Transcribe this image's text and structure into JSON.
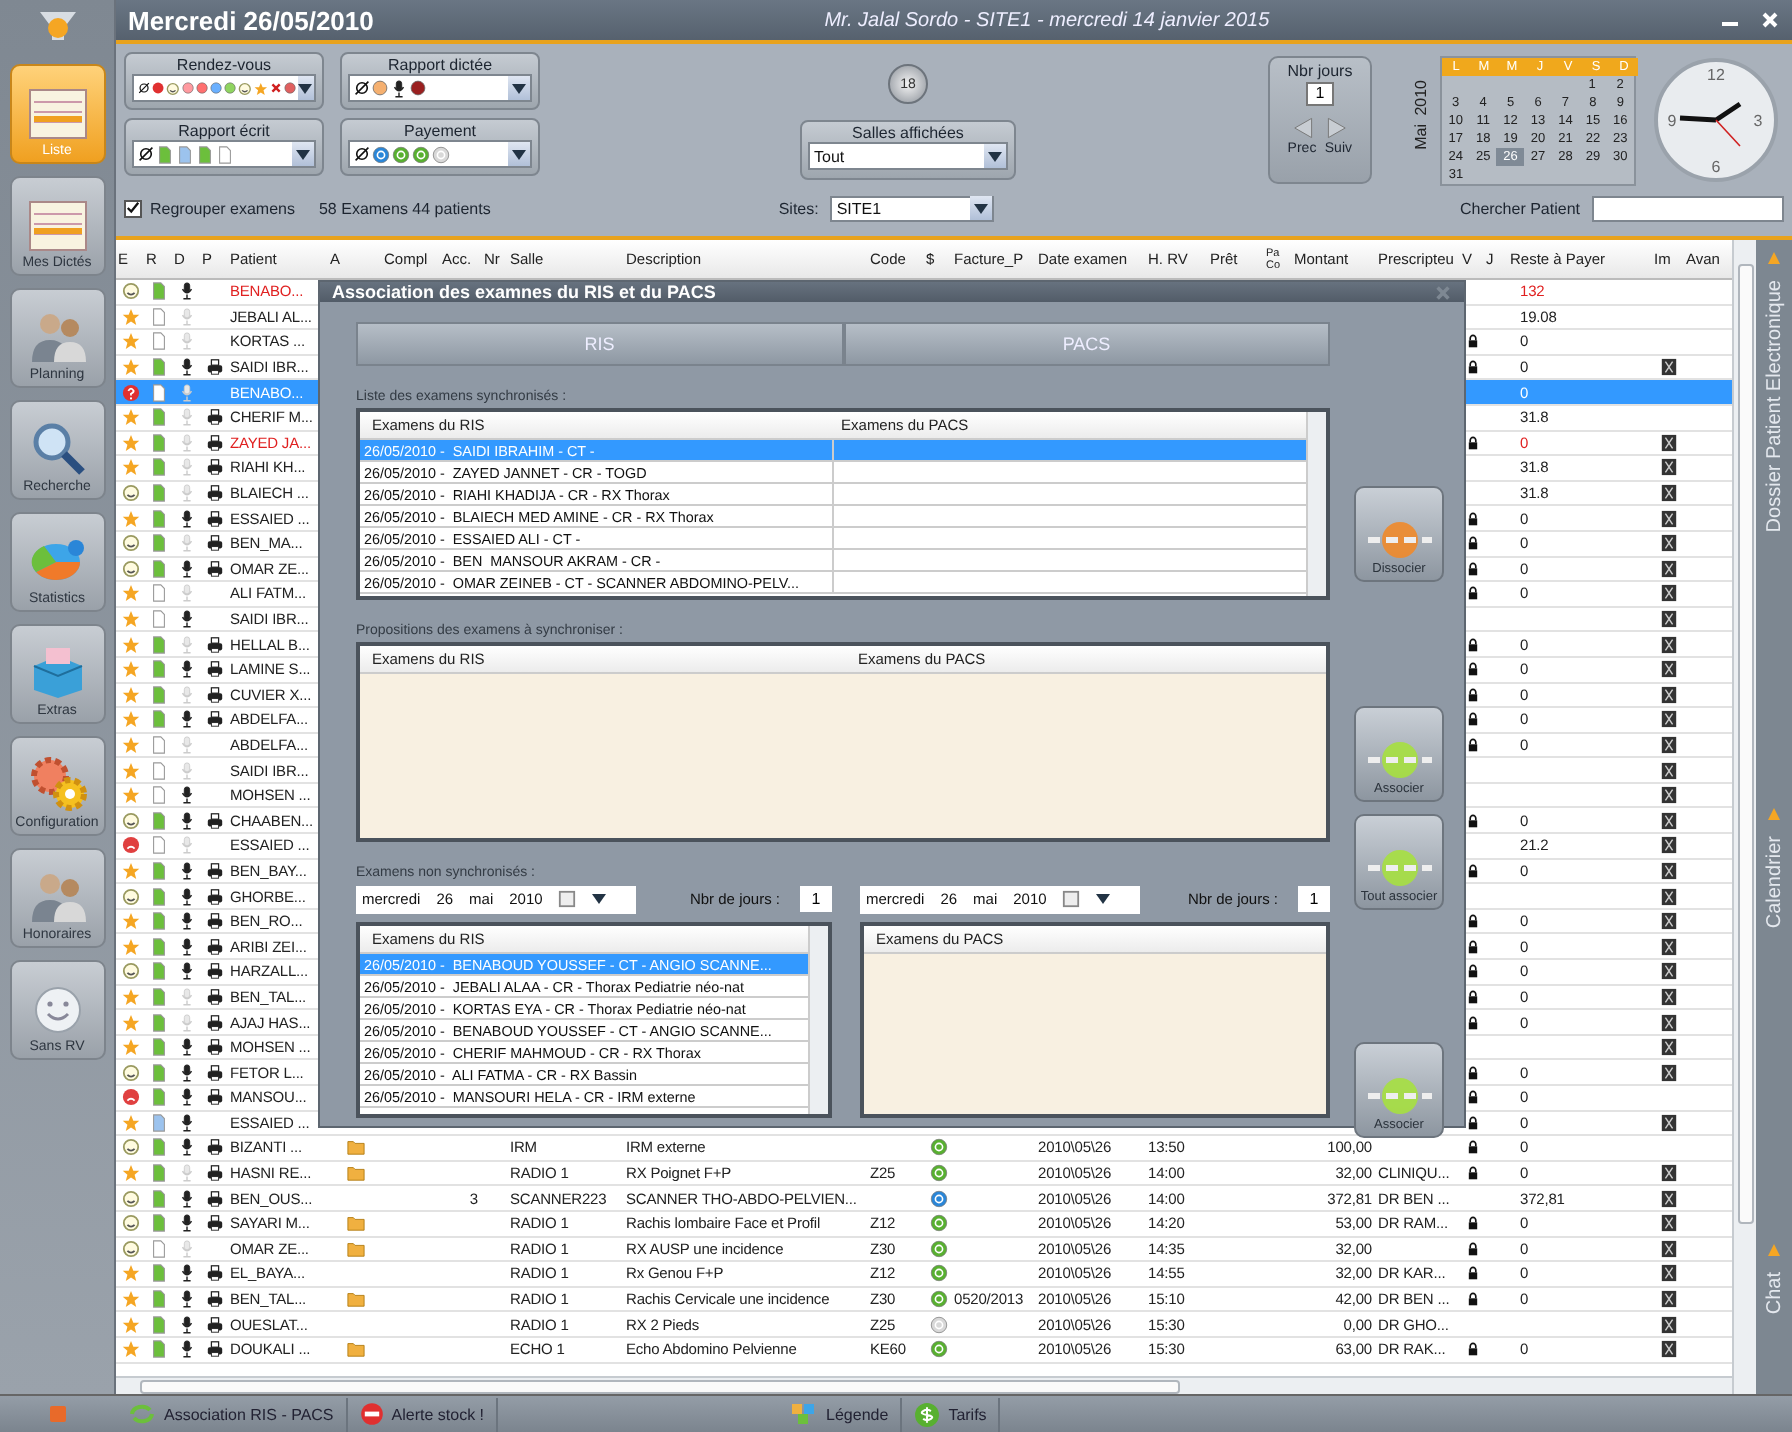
{
  "header": {
    "date": "Mercredi 26/05/2010",
    "title": "Mr. Jalal Sordo - SITE1 - mercredi 14 janvier 2015"
  },
  "sidebar": {
    "items": [
      {
        "label": "Liste",
        "kind": "list",
        "selected": true
      },
      {
        "label": "Mes Dictés",
        "kind": "list",
        "selected": false
      },
      {
        "label": "Planning",
        "kind": "people",
        "selected": false
      },
      {
        "label": "Recherche",
        "kind": "search",
        "selected": false
      },
      {
        "label": "Statistics",
        "kind": "pie",
        "selected": false
      },
      {
        "label": "Extras",
        "kind": "box",
        "selected": false
      },
      {
        "label": "Configuration",
        "kind": "gear",
        "selected": false
      },
      {
        "label": "Honoraires",
        "kind": "people",
        "selected": false
      },
      {
        "label": "Sans RV",
        "kind": "smiley",
        "selected": false
      }
    ]
  },
  "filters": [
    {
      "label": "Rendez-vous",
      "kind": "rdv"
    },
    {
      "label": "Rapport dictée",
      "kind": "dictee"
    },
    {
      "label": "Rapport écrit",
      "kind": "ecrit"
    },
    {
      "label": "Payement",
      "kind": "paiement"
    }
  ],
  "room_count": "18",
  "rooms": {
    "label": "Salles affichées",
    "value": "Tout"
  },
  "days": {
    "label": "Nbr jours",
    "value": "1",
    "prev": "Prec",
    "next": "Suiv"
  },
  "month": {
    "month": "Mai",
    "year": "2010"
  },
  "calendar": {
    "weekdays": [
      "L",
      "M",
      "M",
      "J",
      "V",
      "S",
      "D"
    ],
    "weeks": [
      [
        {
          "d": "1",
          "selected": false
        },
        {
          "d": "2",
          "selected": false
        }
      ],
      [
        {
          "d": "3",
          "selected": false
        },
        {
          "d": "4",
          "selected": false
        },
        {
          "d": "5",
          "selected": false
        },
        {
          "d": "6",
          "selected": false
        },
        {
          "d": "7",
          "selected": false
        },
        {
          "d": "8",
          "selected": false
        },
        {
          "d": "9",
          "selected": false
        }
      ],
      [
        {
          "d": "10",
          "selected": false
        },
        {
          "d": "11",
          "selected": false
        },
        {
          "d": "12",
          "selected": false
        },
        {
          "d": "13",
          "selected": false
        },
        {
          "d": "14",
          "selected": false
        },
        {
          "d": "15",
          "selected": false
        },
        {
          "d": "16",
          "selected": false
        }
      ],
      [
        {
          "d": "17",
          "selected": false
        },
        {
          "d": "18",
          "selected": false
        },
        {
          "d": "19",
          "selected": false
        },
        {
          "d": "20",
          "selected": false
        },
        {
          "d": "21",
          "selected": false
        },
        {
          "d": "22",
          "selected": false
        },
        {
          "d": "23",
          "selected": false
        }
      ],
      [
        {
          "d": "24",
          "selected": false
        },
        {
          "d": "25",
          "selected": false
        },
        {
          "d": "26",
          "selected": true
        },
        {
          "d": "27",
          "selected": false
        },
        {
          "d": "28",
          "selected": false
        },
        {
          "d": "29",
          "selected": false
        },
        {
          "d": "30",
          "selected": false
        }
      ],
      [
        {
          "d": "31",
          "selected": false
        }
      ]
    ]
  },
  "clock": {
    "numerals": [
      "12",
      "3",
      "6",
      "9"
    ]
  },
  "options": {
    "group_label": "Regrouper examens",
    "group_checked": true,
    "summary": "58 Examens 44 patients",
    "sites_label": "Sites:",
    "site": "SITE1",
    "search_label": "Chercher Patient"
  },
  "table": {
    "columns": [
      "E",
      "R",
      "D",
      "P",
      "Patient",
      "A",
      "Compl",
      "Acc.",
      "Nr",
      "Salle",
      "Description",
      "Code",
      "$",
      "Facture_P",
      "Date examen",
      "H. RV",
      "Prêt",
      "Pa Co",
      "Montant",
      "Prescripteu",
      "V",
      "J",
      "Reste à Payer",
      "Im",
      "Avan"
    ],
    "rows": [
      {
        "status": {
          "kind": "smile"
        },
        "report": {
          "kind": "done"
        },
        "d": true,
        "p": false,
        "patient": "BENABO...",
        "flagged": true,
        "selected": false,
        "v": false,
        "reste": "132",
        "reste_flagged": true,
        "im": false
      },
      {
        "status": {
          "kind": "star"
        },
        "report": {
          "kind": "empty"
        },
        "d": false,
        "p": false,
        "patient": "JEBALI AL...",
        "flagged": false,
        "selected": false,
        "v": false,
        "reste": "19.08",
        "reste_flagged": false,
        "im": false
      },
      {
        "status": {
          "kind": "star"
        },
        "report": {
          "kind": "empty"
        },
        "d": false,
        "p": false,
        "patient": "KORTAS ...",
        "flagged": false,
        "selected": false,
        "v": true,
        "reste": "0",
        "reste_flagged": false,
        "im": false
      },
      {
        "status": {
          "kind": "star"
        },
        "report": {
          "kind": "done"
        },
        "d": true,
        "p": true,
        "patient": "SAIDI IBR...",
        "flagged": false,
        "selected": false,
        "v": true,
        "reste": "0",
        "reste_flagged": false,
        "im": true
      },
      {
        "status": {
          "kind": "help"
        },
        "report": {
          "kind": "empty"
        },
        "d": false,
        "p": false,
        "patient": "BENABO...",
        "flagged": false,
        "selected": true,
        "v": false,
        "reste": "0",
        "reste_flagged": false,
        "im": false
      },
      {
        "status": {
          "kind": "star"
        },
        "report": {
          "kind": "done"
        },
        "d": false,
        "p": true,
        "patient": "CHERIF M...",
        "flagged": false,
        "selected": false,
        "v": false,
        "reste": "31.8",
        "reste_flagged": false,
        "im": false
      },
      {
        "status": {
          "kind": "star"
        },
        "report": {
          "kind": "done"
        },
        "d": false,
        "p": true,
        "patient": "ZAYED JA...",
        "flagged": true,
        "selected": false,
        "v": true,
        "reste": "0",
        "reste_flagged": true,
        "im": true
      },
      {
        "status": {
          "kind": "star"
        },
        "report": {
          "kind": "done"
        },
        "d": false,
        "p": true,
        "patient": "RIAHI KH...",
        "flagged": false,
        "selected": false,
        "v": false,
        "reste": "31.8",
        "reste_flagged": false,
        "im": true
      },
      {
        "status": {
          "kind": "smile"
        },
        "report": {
          "kind": "done"
        },
        "d": false,
        "p": true,
        "patient": "BLAIECH ...",
        "flagged": false,
        "selected": false,
        "v": false,
        "reste": "31.8",
        "reste_flagged": false,
        "im": true
      },
      {
        "status": {
          "kind": "star"
        },
        "report": {
          "kind": "done"
        },
        "d": true,
        "p": true,
        "patient": "ESSAIED ...",
        "flagged": false,
        "selected": false,
        "v": true,
        "reste": "0",
        "reste_flagged": false,
        "im": true
      },
      {
        "status": {
          "kind": "smile"
        },
        "report": {
          "kind": "done"
        },
        "d": false,
        "p": true,
        "patient": "BEN_MA...",
        "flagged": false,
        "selected": false,
        "v": true,
        "reste": "0",
        "reste_flagged": false,
        "im": true
      },
      {
        "status": {
          "kind": "smile"
        },
        "report": {
          "kind": "done"
        },
        "d": true,
        "p": true,
        "patient": "OMAR ZE...",
        "flagged": false,
        "selected": false,
        "v": true,
        "reste": "0",
        "reste_flagged": false,
        "im": true
      },
      {
        "status": {
          "kind": "star"
        },
        "report": {
          "kind": "empty"
        },
        "d": false,
        "p": false,
        "patient": "ALI FATM...",
        "flagged": false,
        "selected": false,
        "v": true,
        "reste": "0",
        "reste_flagged": false,
        "im": true
      },
      {
        "status": {
          "kind": "star"
        },
        "report": {
          "kind": "empty"
        },
        "d": true,
        "p": false,
        "patient": "SAIDI IBR...",
        "flagged": false,
        "selected": false,
        "v": false,
        "im": true
      },
      {
        "status": {
          "kind": "star"
        },
        "report": {
          "kind": "done"
        },
        "d": false,
        "p": true,
        "patient": "HELLAL B...",
        "flagged": false,
        "selected": false,
        "v": true,
        "reste": "0",
        "reste_flagged": false,
        "im": true
      },
      {
        "status": {
          "kind": "star"
        },
        "report": {
          "kind": "done"
        },
        "d": true,
        "p": true,
        "patient": "LAMINE S...",
        "flagged": false,
        "selected": false,
        "v": true,
        "reste": "0",
        "reste_flagged": false,
        "im": true
      },
      {
        "status": {
          "kind": "star"
        },
        "report": {
          "kind": "done"
        },
        "d": false,
        "p": true,
        "patient": "CUVIER X...",
        "flagged": false,
        "selected": false,
        "v": true,
        "reste": "0",
        "reste_flagged": false,
        "im": true
      },
      {
        "status": {
          "kind": "star"
        },
        "report": {
          "kind": "done"
        },
        "d": true,
        "p": true,
        "patient": "ABDELFA...",
        "flagged": false,
        "selected": false,
        "v": true,
        "reste": "0",
        "reste_flagged": false,
        "im": true
      },
      {
        "status": {
          "kind": "star"
        },
        "report": {
          "kind": "empty"
        },
        "d": false,
        "p": false,
        "patient": "ABDELFA...",
        "flagged": false,
        "selected": false,
        "v": true,
        "reste": "0",
        "reste_flagged": false,
        "im": true
      },
      {
        "status": {
          "kind": "star"
        },
        "report": {
          "kind": "empty"
        },
        "d": false,
        "p": false,
        "patient": "SAIDI IBR...",
        "flagged": false,
        "selected": false,
        "v": false,
        "im": true
      },
      {
        "status": {
          "kind": "star"
        },
        "report": {
          "kind": "empty"
        },
        "d": true,
        "p": false,
        "patient": "MOHSEN ...",
        "flagged": false,
        "selected": false,
        "v": false,
        "im": true
      },
      {
        "status": {
          "kind": "smile"
        },
        "report": {
          "kind": "done"
        },
        "d": true,
        "p": true,
        "patient": "CHAABEN...",
        "flagged": false,
        "selected": false,
        "v": true,
        "reste": "0",
        "reste_flagged": false,
        "im": true
      },
      {
        "status": {
          "kind": "sad"
        },
        "report": {
          "kind": "empty"
        },
        "d": false,
        "p": false,
        "patient": "ESSAIED ...",
        "flagged": false,
        "selected": false,
        "v": false,
        "reste": "21.2",
        "reste_flagged": false,
        "im": true
      },
      {
        "status": {
          "kind": "star"
        },
        "report": {
          "kind": "done"
        },
        "d": true,
        "p": true,
        "patient": "BEN_BAY...",
        "flagged": false,
        "selected": false,
        "v": true,
        "reste": "0",
        "reste_flagged": false,
        "im": true
      },
      {
        "status": {
          "kind": "smile"
        },
        "report": {
          "kind": "done"
        },
        "d": true,
        "p": true,
        "patient": "GHORBE...",
        "flagged": false,
        "selected": false,
        "v": false,
        "im": true
      },
      {
        "status": {
          "kind": "star"
        },
        "report": {
          "kind": "done"
        },
        "d": true,
        "p": true,
        "patient": "BEN_RO...",
        "flagged": false,
        "selected": false,
        "v": true,
        "reste": "0",
        "reste_flagged": false,
        "im": true
      },
      {
        "status": {
          "kind": "star"
        },
        "report": {
          "kind": "done"
        },
        "d": true,
        "p": true,
        "patient": "ARIBI ZEI...",
        "flagged": false,
        "selected": false,
        "v": true,
        "reste": "0",
        "reste_flagged": false,
        "im": true
      },
      {
        "status": {
          "kind": "smile"
        },
        "report": {
          "kind": "done"
        },
        "d": true,
        "p": true,
        "patient": "HARZALL...",
        "flagged": false,
        "selected": false,
        "v": true,
        "reste": "0",
        "reste_flagged": false,
        "im": true
      },
      {
        "status": {
          "kind": "star"
        },
        "report": {
          "kind": "done"
        },
        "d": false,
        "p": true,
        "patient": "BEN_TAL...",
        "flagged": false,
        "selected": false,
        "v": true,
        "reste": "0",
        "reste_flagged": false,
        "im": true
      },
      {
        "status": {
          "kind": "star"
        },
        "report": {
          "kind": "done"
        },
        "d": false,
        "p": true,
        "patient": "AJAJ HAS...",
        "flagged": false,
        "selected": false,
        "v": true,
        "reste": "0",
        "reste_flagged": false,
        "im": true
      },
      {
        "status": {
          "kind": "star"
        },
        "report": {
          "kind": "done"
        },
        "d": true,
        "p": true,
        "patient": "MOHSEN ...",
        "flagged": false,
        "selected": false,
        "v": false,
        "im": true
      },
      {
        "status": {
          "kind": "smile"
        },
        "report": {
          "kind": "done"
        },
        "d": true,
        "p": true,
        "patient": "FETOR L...",
        "flagged": false,
        "selected": false,
        "v": true,
        "reste": "0",
        "reste_flagged": false,
        "im": true
      },
      {
        "status": {
          "kind": "sad"
        },
        "report": {
          "kind": "done"
        },
        "d": true,
        "p": true,
        "patient": "MANSOU...",
        "flagged": false,
        "selected": false,
        "v": true,
        "reste": "0",
        "reste_flagged": false,
        "im": false
      },
      {
        "status": {
          "kind": "star"
        },
        "report": {
          "kind": "blue"
        },
        "d": true,
        "p": false,
        "patient": "ESSAIED ...",
        "flagged": false,
        "selected": false,
        "v": true,
        "reste": "0",
        "reste_flagged": false,
        "im": true
      },
      {
        "status": {
          "kind": "smile"
        },
        "report": {
          "kind": "done"
        },
        "d": true,
        "p": true,
        "patient": "BIZANTI ...",
        "flagged": false,
        "selected": false,
        "v": true,
        "reste": "0",
        "reste_flagged": false,
        "im": false,
        "detail": {
          "attachment": true,
          "salle": "IRM",
          "description": "IRM externe",
          "payment": {
            "kind": "paid"
          },
          "date": "2010\\05\\26",
          "heure": "13:50",
          "montant": "100,00"
        }
      },
      {
        "status": {
          "kind": "star"
        },
        "report": {
          "kind": "done"
        },
        "d": false,
        "p": true,
        "patient": "HASNI RE...",
        "flagged": false,
        "selected": false,
        "v": true,
        "reste": "0",
        "reste_flagged": false,
        "im": true,
        "detail": {
          "attachment": true,
          "salle": "RADIO 1",
          "description": "RX Poignet F+P",
          "code": "Z25",
          "payment": {
            "kind": "paid"
          },
          "date": "2010\\05\\26",
          "heure": "14:00",
          "montant": "32,00",
          "prescripteur": "CLINIQU..."
        }
      },
      {
        "status": {
          "kind": "smile"
        },
        "report": {
          "kind": "done"
        },
        "d": true,
        "p": true,
        "patient": "BEN_OUS...",
        "flagged": false,
        "selected": false,
        "v": false,
        "reste": "372,81",
        "reste_flagged": false,
        "im": true,
        "detail": {
          "attachment": false,
          "acc": "3",
          "salle": "SCANNER223",
          "description": "SCANNER THO-ABDO-PELVIEN...",
          "payment": {
            "kind": "card"
          },
          "date": "2010\\05\\26",
          "heure": "14:00",
          "montant": "372,81",
          "prescripteur": "DR BEN ..."
        }
      },
      {
        "status": {
          "kind": "smile"
        },
        "report": {
          "kind": "done"
        },
        "d": true,
        "p": true,
        "patient": "SAYARI M...",
        "flagged": false,
        "selected": false,
        "v": true,
        "reste": "0",
        "reste_flagged": false,
        "im": true,
        "detail": {
          "attachment": true,
          "salle": "RADIO 1",
          "description": "Rachis lombaire Face et Profil",
          "code": "Z12",
          "payment": {
            "kind": "paid"
          },
          "date": "2010\\05\\26",
          "heure": "14:20",
          "montant": "53,00",
          "prescripteur": "DR RAM..."
        }
      },
      {
        "status": {
          "kind": "smile"
        },
        "report": {
          "kind": "empty"
        },
        "d": false,
        "p": false,
        "patient": "OMAR ZE...",
        "flagged": false,
        "selected": false,
        "v": true,
        "reste": "0",
        "reste_flagged": false,
        "im": true,
        "detail": {
          "attachment": true,
          "salle": "RADIO 1",
          "description": "RX AUSP une incidence",
          "code": "Z30",
          "payment": {
            "kind": "paid"
          },
          "date": "2010\\05\\26",
          "heure": "14:35",
          "montant": "32,00"
        }
      },
      {
        "status": {
          "kind": "star"
        },
        "report": {
          "kind": "done"
        },
        "d": true,
        "p": true,
        "patient": "EL_BAYA...",
        "flagged": false,
        "selected": false,
        "v": true,
        "reste": "0",
        "reste_flagged": false,
        "im": true,
        "detail": {
          "attachment": false,
          "salle": "RADIO 1",
          "description": "Rx Genou F+P",
          "code": "Z12",
          "payment": {
            "kind": "paid"
          },
          "date": "2010\\05\\26",
          "heure": "14:55",
          "montant": "32,00",
          "prescripteur": "DR KAR..."
        }
      },
      {
        "status": {
          "kind": "star"
        },
        "report": {
          "kind": "done"
        },
        "d": true,
        "p": true,
        "patient": "BEN_TAL...",
        "flagged": false,
        "selected": false,
        "v": true,
        "reste": "0",
        "reste_flagged": false,
        "im": true,
        "detail": {
          "attachment": true,
          "salle": "RADIO 1",
          "description": "Rachis Cervicale une incidence",
          "code": "Z30",
          "payment": {
            "kind": "paid"
          },
          "facture": "0520/2013",
          "date": "2010\\05\\26",
          "heure": "15:10",
          "montant": "42,00",
          "prescripteur": "DR BEN ..."
        }
      },
      {
        "status": {
          "kind": "star"
        },
        "report": {
          "kind": "done"
        },
        "d": true,
        "p": true,
        "patient": "OUESLAT...",
        "flagged": false,
        "selected": false,
        "v": false,
        "im": true,
        "detail": {
          "attachment": false,
          "salle": "RADIO 1",
          "description": "RX 2 Pieds",
          "code": "Z25",
          "payment": {
            "kind": "none"
          },
          "date": "2010\\05\\26",
          "heure": "15:30",
          "montant": "0,00",
          "prescripteur": "DR GHO..."
        }
      },
      {
        "status": {
          "kind": "star"
        },
        "report": {
          "kind": "done"
        },
        "d": true,
        "p": true,
        "patient": "DOUKALI ...",
        "flagged": false,
        "selected": false,
        "v": true,
        "reste": "0",
        "reste_flagged": false,
        "im": true,
        "detail": {
          "attachment": true,
          "salle": "ECHO 1",
          "description": "Echo Abdomino Pelvienne",
          "code": "KE60",
          "payment": {
            "kind": "paid"
          },
          "date": "2010\\05\\26",
          "heure": "15:30",
          "montant": "63,00",
          "prescripteur": "DR RAK..."
        }
      }
    ]
  },
  "dialog": {
    "title": "Association des examnes du RIS et du PACS",
    "tabs": [
      {
        "label": "RIS",
        "selected": false
      },
      {
        "label": "PACS",
        "selected": false
      }
    ],
    "synced": {
      "label": "Liste des examens synchronisés :",
      "columns": [
        "Examens du RIS",
        "Examens du PACS"
      ],
      "rows": [
        {
          "ris": "26/05/2010 -  SAIDI IBRAHIM - CT -",
          "selected": true
        },
        {
          "ris": "26/05/2010 -  ZAYED JANNET - CR - TOGD",
          "selected": false
        },
        {
          "ris": "26/05/2010 -  RIAHI KHADIJA - CR - RX Thorax",
          "selected": false
        },
        {
          "ris": "26/05/2010 -  BLAIECH MED AMINE - CR - RX Thorax",
          "selected": false
        },
        {
          "ris": "26/05/2010 -  ESSAIED ALI - CT -",
          "selected": false
        },
        {
          "ris": "26/05/2010 -  BEN  MANSOUR AKRAM - CR -",
          "selected": false
        },
        {
          "ris": "26/05/2010 -  OMAR ZEINEB - CT - SCANNER ABDOMINO-PELV...",
          "selected": false
        }
      ]
    },
    "dissociate": "Dissocier",
    "proposals": {
      "label": "Propositions des examens à synchroniser :",
      "columns": [
        "Examens du RIS",
        "Examens du PACS"
      ]
    },
    "associate": "Associer",
    "associate_all": "Tout associer",
    "unsynced": {
      "label": "Examens non synchronisés :",
      "ris": {
        "date": [
          "mercredi",
          "26",
          "mai",
          "2010"
        ],
        "days_label": "Nbr de jours :",
        "days": "1",
        "column": "Examens du RIS",
        "rows": [
          {
            "ris": "26/05/2010 -  BENABOUD YOUSSEF - CT - ANGIO SCANNE...",
            "selected": true
          },
          {
            "ris": "26/05/2010 -  JEBALI ALAA - CR - Thorax Pediatrie néo-nat",
            "selected": false
          },
          {
            "ris": "26/05/2010 -  KORTAS EYA - CR - Thorax Pediatrie néo-nat",
            "selected": false
          },
          {
            "ris": "26/05/2010 -  BENABOUD YOUSSEF - CT - ANGIO SCANNE...",
            "selected": false
          },
          {
            "ris": "26/05/2010 -  CHERIF MAHMOUD - CR - RX Thorax",
            "selected": false
          },
          {
            "ris": "26/05/2010 -  ALI FATMA - CR - RX Bassin",
            "selected": false
          },
          {
            "ris": "26/05/2010 -  MANSOURI HELA - CR - IRM externe",
            "selected": false
          }
        ]
      },
      "pacs": {
        "date": [
          "mercredi",
          "26",
          "mai",
          "2010"
        ],
        "days_label": "Nbr de jours :",
        "days": "1",
        "column": "Examens du PACS"
      }
    },
    "associate2": "Associer"
  },
  "side_tabs": [
    "Dossier Patient Electronique",
    "Calendrier",
    "Chat"
  ],
  "status_bar": [
    {
      "label": "Association RIS - PACS",
      "kind": "sync"
    },
    {
      "label": "Alerte stock !",
      "kind": "alert"
    },
    {
      "label": "Légende",
      "kind": "legend"
    },
    {
      "label": "Tarifs",
      "kind": "money"
    }
  ]
}
